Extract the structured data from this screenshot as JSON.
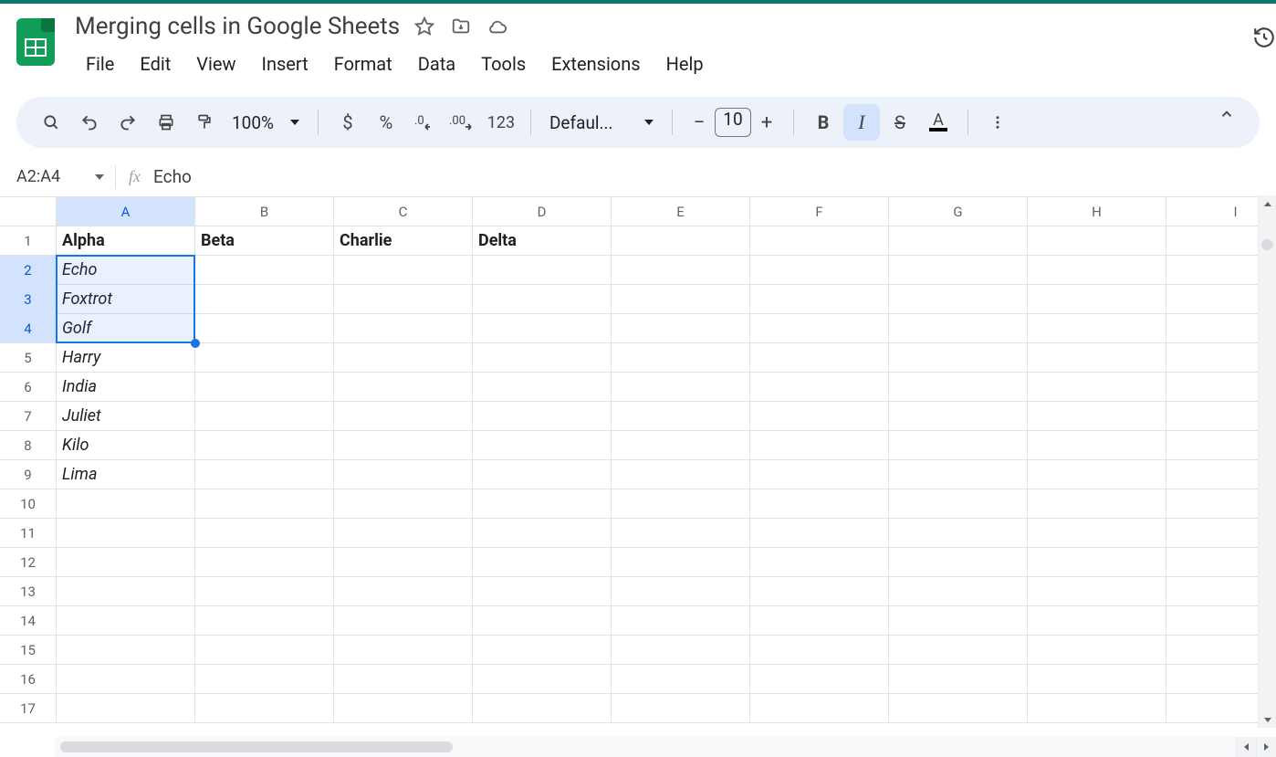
{
  "doc": {
    "title": "Merging cells in Google Sheets"
  },
  "menus": [
    "File",
    "Edit",
    "View",
    "Insert",
    "Format",
    "Data",
    "Tools",
    "Extensions",
    "Help"
  ],
  "toolbar": {
    "zoom": "100%",
    "font": "Defaul...",
    "fontSize": "10",
    "currency": "$",
    "percent": "%",
    "decDec": ".0",
    "incDec": ".00",
    "numFmt": "123"
  },
  "namebox": {
    "ref": "A2:A4",
    "fx": "fx",
    "formula": "Echo"
  },
  "columns": [
    "A",
    "B",
    "C",
    "D",
    "E",
    "F",
    "G",
    "H",
    "I"
  ],
  "rowCount": 17,
  "selectedCol": "A",
  "selectedRows": [
    2,
    3,
    4
  ],
  "cells": {
    "r1": {
      "A": "Alpha",
      "B": "Beta",
      "C": "Charlie",
      "D": "Delta"
    },
    "r2": {
      "A": "Echo"
    },
    "r3": {
      "A": "Foxtrot"
    },
    "r4": {
      "A": "Golf"
    },
    "r5": {
      "A": "Harry"
    },
    "r6": {
      "A": "India"
    },
    "r7": {
      "A": "Juliet"
    },
    "r8": {
      "A": "Kilo"
    },
    "r9": {
      "A": "Lima"
    }
  },
  "selection": {
    "startRow": 2,
    "endRow": 4,
    "col": "A"
  }
}
